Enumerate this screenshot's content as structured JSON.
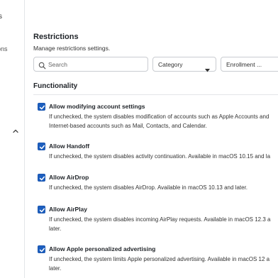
{
  "sidebar": {
    "fragment_top": "s",
    "fragment_item": "ons",
    "chevron_icon": "chevron-up-icon"
  },
  "page": {
    "title": "Restrictions",
    "subtitle": "Manage restrictions settings."
  },
  "filters": {
    "search_placeholder": "Search",
    "category_label": "Category",
    "enrollment_label": "Enrollment ..."
  },
  "section_title": "Functionality",
  "colors": {
    "checkbox_blue": "#1d5fbf",
    "border": "#c9ccd1",
    "divider": "#e3e5e8"
  },
  "items": [
    {
      "label": "Allow modifying account settings",
      "checked": true,
      "description": "If unchecked, the system disables modification of accounts such as Apple Accounts and Internet-based accounts such as Mail, Contacts, and Calendar."
    },
    {
      "label": "Allow Handoff",
      "checked": true,
      "description": "If unchecked, the system disables activity continuation. Available in macOS 10.15 and la"
    },
    {
      "label": "Allow AirDrop",
      "checked": true,
      "description": "If unchecked, the system disables AirDrop. Available in macOS 10.13 and later."
    },
    {
      "label": "Allow AirPlay",
      "checked": true,
      "description": "If unchecked, the system disables incoming AirPlay requests. Available in macOS 12.3 a later."
    },
    {
      "label": "Allow Apple personalized advertising",
      "checked": true,
      "description": "If unchecked, the system limits Apple personalized advertising. Available in macOS 12 a later."
    }
  ]
}
